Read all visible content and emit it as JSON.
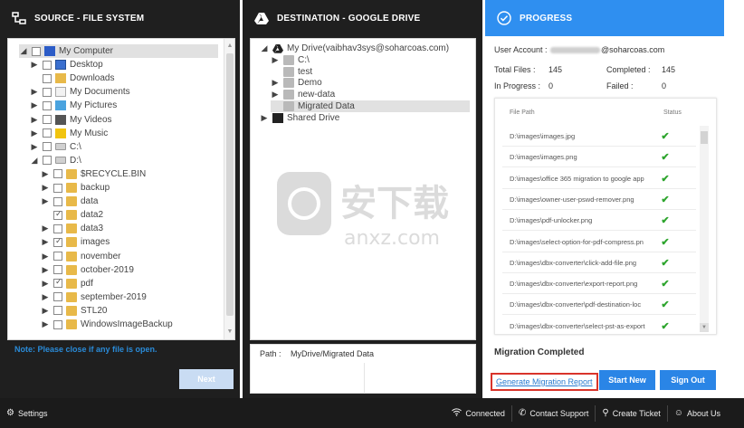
{
  "source": {
    "title": "SOURCE - FILE SYSTEM",
    "tree": [
      {
        "label": "My Computer",
        "arrow": "◢",
        "icon": "pc",
        "indent": 0,
        "checkbox": true,
        "checked": false,
        "selected": true
      },
      {
        "label": "Desktop",
        "arrow": "▶",
        "icon": "monitor",
        "indent": 1,
        "checkbox": true,
        "checked": false
      },
      {
        "label": "Downloads",
        "arrow": "",
        "icon": "dl",
        "indent": 1,
        "checkbox": true,
        "checked": false
      },
      {
        "label": "My Documents",
        "arrow": "▶",
        "icon": "doc",
        "indent": 1,
        "checkbox": true,
        "checked": false
      },
      {
        "label": "My Pictures",
        "arrow": "▶",
        "icon": "pics",
        "indent": 1,
        "checkbox": true,
        "checked": false
      },
      {
        "label": "My Videos",
        "arrow": "▶",
        "icon": "vid",
        "indent": 1,
        "checkbox": true,
        "checked": false
      },
      {
        "label": "My Music",
        "arrow": "▶",
        "icon": "music",
        "indent": 1,
        "checkbox": true,
        "checked": false
      },
      {
        "label": "C:\\",
        "arrow": "▶",
        "icon": "drive",
        "indent": 1,
        "checkbox": true,
        "checked": false
      },
      {
        "label": "D:\\",
        "arrow": "◢",
        "icon": "drive",
        "indent": 1,
        "checkbox": true,
        "checked": false
      },
      {
        "label": "$RECYCLE.BIN",
        "arrow": "▶",
        "icon": "folder",
        "indent": 2,
        "checkbox": true,
        "checked": false
      },
      {
        "label": "backup",
        "arrow": "▶",
        "icon": "folder",
        "indent": 2,
        "checkbox": true,
        "checked": false
      },
      {
        "label": "data",
        "arrow": "▶",
        "icon": "folder",
        "indent": 2,
        "checkbox": true,
        "checked": false
      },
      {
        "label": "data2",
        "arrow": "",
        "icon": "folder",
        "indent": 2,
        "checkbox": true,
        "checked": true
      },
      {
        "label": "data3",
        "arrow": "▶",
        "icon": "folder",
        "indent": 2,
        "checkbox": true,
        "checked": false
      },
      {
        "label": "images",
        "arrow": "▶",
        "icon": "folder",
        "indent": 2,
        "checkbox": true,
        "checked": true
      },
      {
        "label": "november",
        "arrow": "▶",
        "icon": "folder",
        "indent": 2,
        "checkbox": true,
        "checked": false
      },
      {
        "label": "october-2019",
        "arrow": "▶",
        "icon": "folder",
        "indent": 2,
        "checkbox": true,
        "checked": false
      },
      {
        "label": "pdf",
        "arrow": "▶",
        "icon": "folder",
        "indent": 2,
        "checkbox": true,
        "checked": true
      },
      {
        "label": "september-2019",
        "arrow": "▶",
        "icon": "folder",
        "indent": 2,
        "checkbox": true,
        "checked": false
      },
      {
        "label": "STL20",
        "arrow": "▶",
        "icon": "folder",
        "indent": 2,
        "checkbox": true,
        "checked": false
      },
      {
        "label": "WindowsImageBackup",
        "arrow": "▶",
        "icon": "folder",
        "indent": 2,
        "checkbox": true,
        "checked": false
      }
    ],
    "note": "Note: Please close if any file is open.",
    "next_label": "Next"
  },
  "destination": {
    "title": "DESTINATION - GOOGLE DRIVE",
    "tree": [
      {
        "label": "My Drive(vaibhav3sys@soharcoas.com)",
        "arrow": "◢",
        "icon": "gdrive",
        "indent": 0
      },
      {
        "label": "C:\\",
        "arrow": "▶",
        "icon": "folder-gray",
        "indent": 1
      },
      {
        "label": "test",
        "arrow": "",
        "icon": "folder-gray",
        "indent": 1
      },
      {
        "label": "Demo",
        "arrow": "▶",
        "icon": "folder-gray",
        "indent": 1
      },
      {
        "label": "new-data",
        "arrow": "▶",
        "icon": "folder-gray",
        "indent": 1
      },
      {
        "label": "Migrated Data",
        "arrow": "",
        "icon": "folder-gray",
        "indent": 1,
        "selected": true
      },
      {
        "label": "Shared Drive",
        "arrow": "▶",
        "icon": "shared",
        "indent": 0
      }
    ],
    "path_label": "Path :",
    "path_value": "MyDrive/Migrated Data"
  },
  "progress": {
    "title": "PROGRESS",
    "user_account_label": "User Account :",
    "user_account_suffix": "@soharcoas.com",
    "total_files_label": "Total Files :",
    "total_files": "145",
    "completed_label": "Completed :",
    "completed": "145",
    "in_progress_label": "In Progress :",
    "in_progress": "0",
    "failed_label": "Failed :",
    "failed": "0",
    "col_file_path": "File Path",
    "col_status": "Status",
    "rows": [
      "D:\\images\\images.jpg",
      "D:\\images\\images.png",
      "D:\\images\\office 365 migration to google app",
      "D:\\images\\owner-user-pswd-remover.png",
      "D:\\images\\pdf-unlocker.png",
      "D:\\images\\select-option-for-pdf-compress.pn",
      "D:\\images\\dbx-converter\\click-add-file.png",
      "D:\\images\\dbx-converter\\export-report.png",
      "D:\\images\\dbx-converter\\pdf-destination-loc",
      "D:\\images\\dbx-converter\\select-pst-as-export"
    ],
    "migration_status": "Migration Completed",
    "generate_report": "Generate Migration Report",
    "start_new": "Start New",
    "sign_out": "Sign Out"
  },
  "statusbar": {
    "settings": "Settings",
    "connected": "Connected",
    "contact_support": "Contact Support",
    "create_ticket": "Create Ticket",
    "about_us": "About Us"
  },
  "watermark": {
    "text": "安下载",
    "subtext": "anxz.com"
  },
  "colors": {
    "accent": "#2f8ff0",
    "dark": "#1f1f1f",
    "success": "#2ea52e",
    "highlight": "#d9342b"
  }
}
